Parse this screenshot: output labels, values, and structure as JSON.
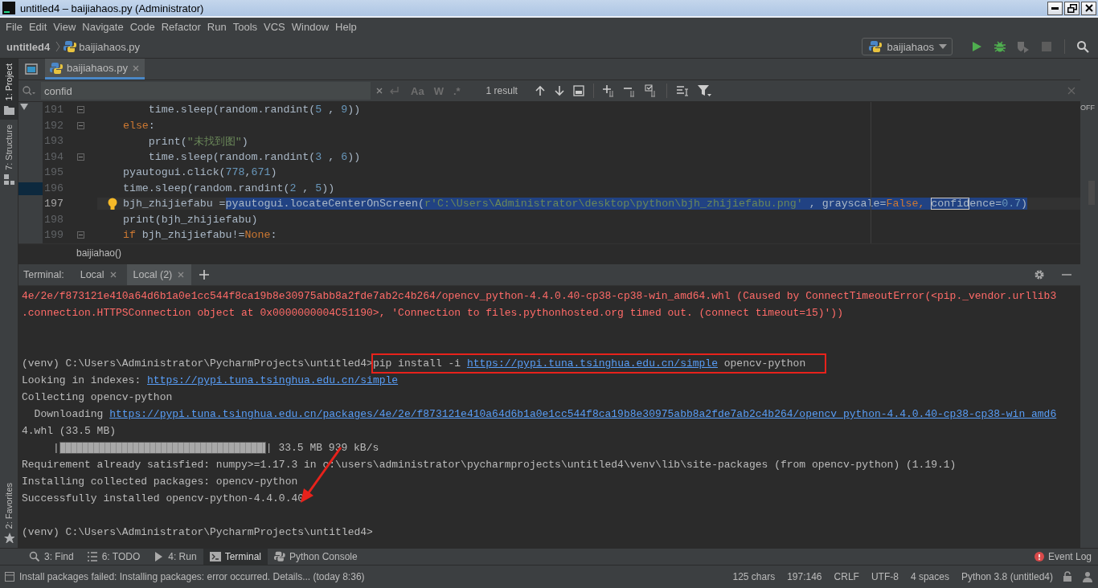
{
  "window": {
    "title": "untitled4 – baijiahaos.py (Administrator)"
  },
  "menu": [
    "File",
    "Edit",
    "View",
    "Navigate",
    "Code",
    "Refactor",
    "Run",
    "Tools",
    "VCS",
    "Window",
    "Help"
  ],
  "breadcrumbs": [
    {
      "label": "untitled4",
      "kind": "project"
    },
    {
      "label": "baijiahaos.py",
      "kind": "file"
    }
  ],
  "run_config": {
    "label": "baijiahaos"
  },
  "side_tabs_left": [
    {
      "label": "1: Project",
      "kind": "project",
      "selected": true
    },
    {
      "label": "7: Structure",
      "kind": "structure",
      "selected": false
    },
    {
      "label": "2: Favorites",
      "kind": "favorites",
      "selected": false
    }
  ],
  "editor_tabs": [
    {
      "label": "baijiahaos.py",
      "selected": true
    }
  ],
  "search": {
    "value": "confid",
    "options": [
      "Aa",
      "W",
      ".*"
    ],
    "result": "1 result"
  },
  "inspection": "OFF",
  "code_lines": [
    {
      "number": "191",
      "fold": true,
      "current": false,
      "bulb": false,
      "segments": [
        {
          "text": "        time.sleep(random.randint(",
          "kind": "plain"
        },
        {
          "text": "5",
          "kind": "number"
        },
        {
          "text": " , ",
          "kind": "plain"
        },
        {
          "text": "9",
          "kind": "number"
        },
        {
          "text": "))",
          "kind": "plain"
        }
      ]
    },
    {
      "number": "192",
      "fold": true,
      "current": false,
      "bulb": false,
      "segments": [
        {
          "text": "    else",
          "kind": "keyword"
        },
        {
          "text": ":",
          "kind": "plain"
        }
      ]
    },
    {
      "number": "193",
      "fold": false,
      "current": false,
      "bulb": false,
      "segments": [
        {
          "text": "        print(",
          "kind": "plain"
        },
        {
          "text": "\"未找到图\"",
          "kind": "string"
        },
        {
          "text": ")",
          "kind": "plain"
        }
      ]
    },
    {
      "number": "194",
      "fold": true,
      "current": false,
      "bulb": false,
      "segments": [
        {
          "text": "        time.sleep(random.randint(",
          "kind": "plain"
        },
        {
          "text": "3",
          "kind": "number"
        },
        {
          "text": " , ",
          "kind": "plain"
        },
        {
          "text": "6",
          "kind": "number"
        },
        {
          "text": "))",
          "kind": "plain"
        }
      ]
    },
    {
      "number": "195",
      "fold": false,
      "current": false,
      "bulb": false,
      "segments": [
        {
          "text": "    pyautogui.click(",
          "kind": "plain"
        },
        {
          "text": "778",
          "kind": "number"
        },
        {
          "text": ",",
          "kind": "plain"
        },
        {
          "text": "671",
          "kind": "number"
        },
        {
          "text": ")",
          "kind": "plain"
        }
      ]
    },
    {
      "number": "196",
      "fold": false,
      "current": false,
      "bulb": false,
      "segments": [
        {
          "text": "    time.sleep(random.randint(",
          "kind": "plain"
        },
        {
          "text": "2",
          "kind": "number"
        },
        {
          "text": " , ",
          "kind": "plain"
        },
        {
          "text": "5",
          "kind": "number"
        },
        {
          "text": "))",
          "kind": "plain"
        }
      ]
    },
    {
      "number": "197",
      "fold": false,
      "current": true,
      "bulb": true,
      "segments": [
        {
          "text": "    bjh_zhijiefabu =",
          "kind": "plain"
        }
      ],
      "selection": [
        {
          "text": "pyautogui.locateCenterOnScreen(",
          "kind": "plain"
        },
        {
          "text": "r'C:\\Users\\Administrator\\desktop\\python\\bjh_zhijiefabu.png'",
          "kind": "string"
        },
        {
          "text": " , grayscale=",
          "kind": "plain"
        },
        {
          "text": "False, ",
          "kind": "keyword"
        },
        {
          "text": "confid",
          "kind": "match"
        },
        {
          "text": "ence=",
          "kind": "plain"
        },
        {
          "text": "0.7",
          "kind": "number"
        },
        {
          "text": ")",
          "kind": "plain"
        }
      ]
    },
    {
      "number": "198",
      "fold": false,
      "current": false,
      "bulb": false,
      "segments": [
        {
          "text": "    print(bjh_zhijiefabu)",
          "kind": "plain"
        }
      ]
    },
    {
      "number": "199",
      "fold": true,
      "current": false,
      "bulb": false,
      "segments": [
        {
          "text": "    if",
          "kind": "keyword"
        },
        {
          "text": " bjh_zhijiefabu!=",
          "kind": "plain"
        },
        {
          "text": "None",
          "kind": "keyword"
        },
        {
          "text": ":",
          "kind": "plain"
        }
      ]
    }
  ],
  "editor_breadcrumb": "baijiahao()",
  "terminal": {
    "title": "Terminal:",
    "tabs": [
      {
        "label": "Local",
        "selected": false
      },
      {
        "label": "Local (2)",
        "selected": true
      }
    ],
    "lines": [
      {
        "kind": "text",
        "segments": [
          {
            "text": "4e/2e/f873121e410a64d6b1a0e1cc544f8ca19b8e30975abb8a2fde7ab2c4b264/opencv_python-4.4.0.40-cp38-cp38-win_amd64.whl (Caused by ConnectTimeoutError(<pip._vendor.urllib3",
            "kind": "error"
          }
        ]
      },
      {
        "kind": "text",
        "segments": [
          {
            "text": ".connection.HTTPSConnection object at 0x0000000004C51190>, 'Connection to files.pythonhosted.org timed out. (connect timeout=15)'))",
            "kind": "error"
          }
        ]
      },
      {
        "kind": "blank"
      },
      {
        "kind": "blank"
      },
      {
        "kind": "text",
        "segments": [
          {
            "text": "(venv) C:\\Users\\Administrator\\PycharmProjects\\untitled4>",
            "kind": "plain"
          },
          {
            "text": "pip install -i ",
            "kind": "plain",
            "framed": true
          },
          {
            "text": "https://pypi.tuna.tsinghua.edu.cn/simple",
            "kind": "link",
            "framed": true
          },
          {
            "text": " opencv-python",
            "kind": "plain",
            "framed": true
          }
        ]
      },
      {
        "kind": "text",
        "segments": [
          {
            "text": "Looking in indexes: ",
            "kind": "plain"
          },
          {
            "text": "https://pypi.tuna.tsinghua.edu.cn/simple",
            "kind": "link"
          }
        ]
      },
      {
        "kind": "text",
        "segments": [
          {
            "text": "Collecting opencv-python",
            "kind": "plain"
          }
        ]
      },
      {
        "kind": "text",
        "segments": [
          {
            "text": "  Downloading ",
            "kind": "plain"
          },
          {
            "text": "https://pypi.tuna.tsinghua.edu.cn/packages/4e/2e/f873121e410a64d6b1a0e1cc544f8ca19b8e30975abb8a2fde7ab2c4b264/opencv_python-4.4.0.40-cp38-cp38-win_amd6",
            "kind": "link"
          }
        ]
      },
      {
        "kind": "text",
        "segments": [
          {
            "text": "4.whl (33.5 MB)",
            "kind": "plain"
          }
        ]
      },
      {
        "kind": "progress",
        "prefix": "     |",
        "level": 1,
        "suffix": "| 33.5 MB 939 kB/s"
      },
      {
        "kind": "text",
        "segments": [
          {
            "text": "Requirement already satisfied: numpy>=1.17.3 in c:\\users\\administrator\\pycharmprojects\\untitled4\\venv\\lib\\site-packages (from opencv-python) (1.19.1)",
            "kind": "plain"
          }
        ]
      },
      {
        "kind": "text",
        "segments": [
          {
            "text": "Installing collected packages: opencv-python",
            "kind": "plain"
          }
        ]
      },
      {
        "kind": "text",
        "arrow": true,
        "segments": [
          {
            "text": "Successfully installed opencv-python-4.4.0.40",
            "kind": "plain"
          }
        ]
      },
      {
        "kind": "blank"
      },
      {
        "kind": "text",
        "segments": [
          {
            "text": "(venv) C:\\Users\\Administrator\\PycharmProjects\\untitled4>",
            "kind": "plain"
          }
        ]
      }
    ]
  },
  "tool_tabs": [
    {
      "label": "3: Find",
      "kind": "find",
      "selected": false
    },
    {
      "label": "6: TODO",
      "kind": "todo",
      "selected": false
    },
    {
      "label": "4: Run",
      "kind": "run",
      "selected": false
    },
    {
      "label": "Terminal",
      "kind": "terminal",
      "selected": true
    },
    {
      "label": "Python Console",
      "kind": "console",
      "selected": false
    }
  ],
  "event_log": "Event Log",
  "status_bar": {
    "message": "Install packages failed: Installing packages: error occurred. Details... (today 8:36)",
    "items": [
      "125 chars",
      "197:146",
      "CRLF",
      "UTF-8",
      "4 spaces",
      "Python 3.8 (untitled4)"
    ]
  }
}
